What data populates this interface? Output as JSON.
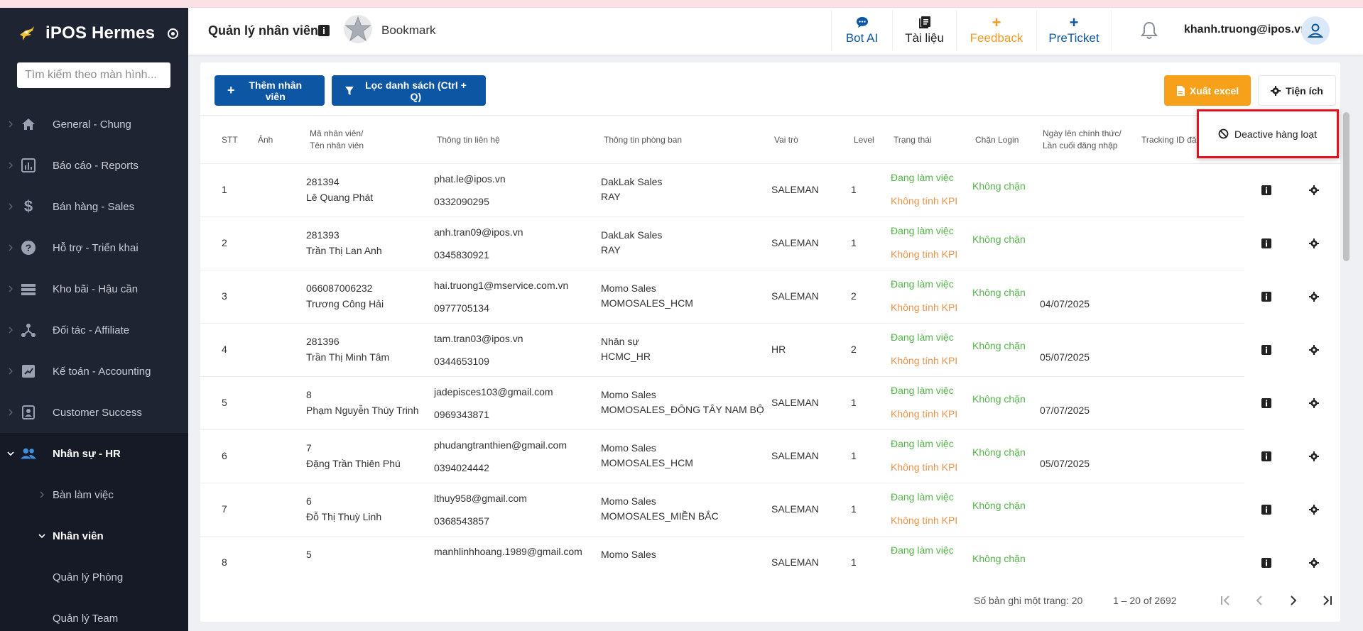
{
  "sidebar": {
    "brand": "iPOS Hermes",
    "search_placeholder": "Tìm kiếm theo màn hình...",
    "items": [
      {
        "label": "General - Chung",
        "icon": "home-icon"
      },
      {
        "label": "Báo cáo - Reports",
        "icon": "chart-icon"
      },
      {
        "label": "Bán hàng - Sales",
        "icon": "dollar-icon"
      },
      {
        "label": "Hỗ trợ - Triển khai",
        "icon": "help-icon"
      },
      {
        "label": "Kho bãi - Hậu cần",
        "icon": "warehouse-icon"
      },
      {
        "label": "Đối tác - Affiliate",
        "icon": "affiliate-icon"
      },
      {
        "label": "Kế toán - Accounting",
        "icon": "accounting-icon"
      },
      {
        "label": "Customer Success",
        "icon": "customer-icon"
      },
      {
        "label": "Nhân sự - HR",
        "icon": "people-icon"
      }
    ],
    "hr_sub": [
      {
        "label": "Bàn làm việc"
      },
      {
        "label": "Nhân viên"
      },
      {
        "label": "Quản lý Phòng"
      },
      {
        "label": "Quản lý Team"
      }
    ]
  },
  "header": {
    "title": "Quản lý nhân viên",
    "bookmark": "Bookmark",
    "buttons": {
      "bot": "Bot AI",
      "docs": "Tài liệu",
      "feedback": "Feedback",
      "preticket": "PreTicket"
    },
    "user_email": "khanh.truong@ipos.vn"
  },
  "toolbar": {
    "add": "Thêm nhân viên",
    "filter": "Lọc danh sách (Ctrl + Q)",
    "excel": "Xuất excel",
    "util": "Tiện ích"
  },
  "dropdown": {
    "deactivate": "Deactive hàng loạt"
  },
  "table": {
    "headers": {
      "stt": "STT",
      "photo": "Ảnh",
      "code_1": "Mã nhân viên/",
      "code_2": "Tên nhân viên",
      "contact": "Thông tin liên hệ",
      "dept": "Thông tin phòng ban",
      "role": "Vai trò",
      "level": "Level",
      "status": "Trạng thái",
      "block": "Chặn Login",
      "date_1": "Ngày lên chính thức/",
      "date_2": "Lần cuối đăng nhập",
      "tracking": "Tracking ID đăng"
    },
    "rows": [
      {
        "stt": "1",
        "code": "281394",
        "name": "Lê Quang Phát",
        "email": "phat.le@ipos.vn",
        "phone": "0332090295",
        "dept": "DakLak Sales",
        "dept_code": "RAY",
        "role": "SALEMAN",
        "level": "1",
        "status": "Đang làm việc",
        "kpi": "Không tính KPI",
        "block": "Không chặn",
        "date": ""
      },
      {
        "stt": "2",
        "code": "281393",
        "name": "Trần Thị Lan Anh",
        "email": "anh.tran09@ipos.vn",
        "phone": "0345830921",
        "dept": "DakLak Sales",
        "dept_code": "RAY",
        "role": "SALEMAN",
        "level": "1",
        "status": "Đang làm việc",
        "kpi": "Không tính KPI",
        "block": "Không chặn",
        "date": ""
      },
      {
        "stt": "3",
        "code": "066087006232",
        "name": "Trương Công Hải",
        "email": "hai.truong1@mservice.com.vn",
        "phone": "0977705134",
        "dept": "Momo Sales",
        "dept_code": "MOMOSALES_HCM",
        "role": "SALEMAN",
        "level": "2",
        "status": "Đang làm việc",
        "kpi": "Không tính KPI",
        "block": "Không chặn",
        "date": "04/07/2025"
      },
      {
        "stt": "4",
        "code": "281396",
        "name": "Trần Thị Minh Tâm",
        "email": "tam.tran03@ipos.vn",
        "phone": "0344653109",
        "dept": "Nhân sự",
        "dept_code": "HCMC_HR",
        "role": "HR",
        "level": "2",
        "status": "Đang làm việc",
        "kpi": "Không tính KPI",
        "block": "Không chặn",
        "date": "05/07/2025"
      },
      {
        "stt": "5",
        "code": "8",
        "name": "Phạm Nguyễn Thùy Trinh",
        "email": "jadepisces103@gmail.com",
        "phone": "0969343871",
        "dept": "Momo Sales",
        "dept_code": "MOMOSALES_ĐÔNG TÂY NAM BỘ",
        "role": "SALEMAN",
        "level": "1",
        "status": "Đang làm việc",
        "kpi": "Không tính KPI",
        "block": "Không chặn",
        "date": "07/07/2025"
      },
      {
        "stt": "6",
        "code": "7",
        "name": "Đặng Trần Thiên Phú",
        "email": "phudangtranthien@gmail.com",
        "phone": "0394024442",
        "dept": "Momo Sales",
        "dept_code": "MOMOSALES_HCM",
        "role": "SALEMAN",
        "level": "1",
        "status": "Đang làm việc",
        "kpi": "Không tính KPI",
        "block": "Không chặn",
        "date": "05/07/2025"
      },
      {
        "stt": "7",
        "code": "6",
        "name": "Đỗ Thị Thuỳ Linh",
        "email": "lthuy958@gmail.com",
        "phone": "0368543857",
        "dept": "Momo Sales",
        "dept_code": "MOMOSALES_MIỀN BẮC",
        "role": "SALEMAN",
        "level": "1",
        "status": "Đang làm việc",
        "kpi": "Không tính KPI",
        "block": "Không chặn",
        "date": ""
      },
      {
        "stt": "8",
        "code": "5",
        "name": "",
        "email": "manhlinhhoang.1989@gmail.com",
        "phone": "",
        "dept": "Momo Sales",
        "dept_code": "",
        "role": "SALEMAN",
        "level": "1",
        "status": "Đang làm việc",
        "kpi": "",
        "block": "Không chặn",
        "date": ""
      }
    ]
  },
  "pager": {
    "per_page_label": "Số bản ghi một trang: 20",
    "range": "1 – 20 of 2692"
  },
  "colors": {
    "sidebar_bg": "#1f2433",
    "primary": "#0d56a4",
    "excel": "#f7a11a",
    "status_green": "#55b34a",
    "kpi_orange": "#e8934a",
    "highlight_red": "#e6121b"
  }
}
